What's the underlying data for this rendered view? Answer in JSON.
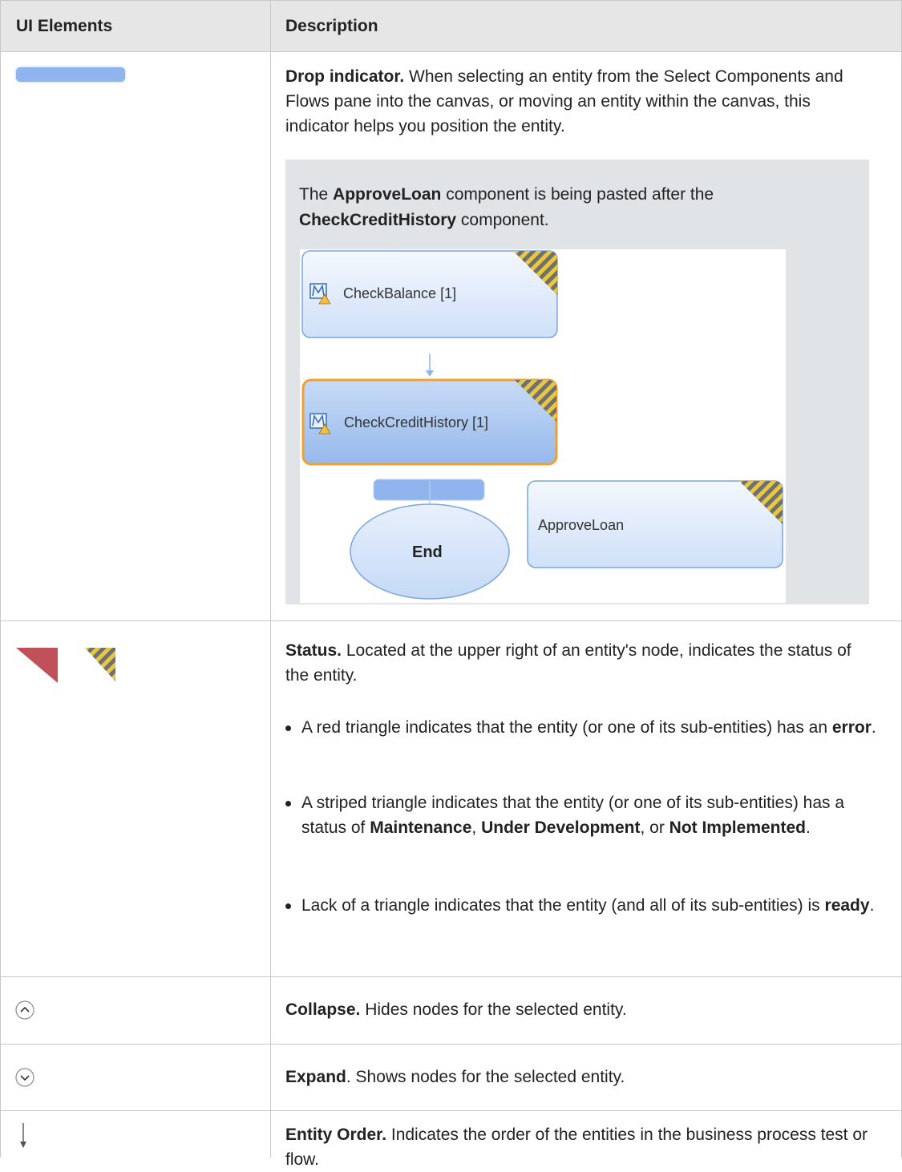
{
  "header": {
    "col1": "UI Elements",
    "col2": "Description"
  },
  "rows": {
    "drop": {
      "title": "Drop indicator.",
      "text": " When selecting an entity from the Select Components and Flows pane into the canvas, or moving an entity within the canvas, this indicator helps you position the entity.",
      "note": {
        "pre": "The ",
        "b1": "ApproveLoan",
        "mid": " component is being pasted after the ",
        "b2": "CheckCreditHistory",
        "post": " component."
      },
      "diagram": {
        "node1": "CheckBalance [1]",
        "node2": "CheckCreditHistory [1]",
        "end": "End",
        "pending": "ApproveLoan"
      }
    },
    "status": {
      "title": "Status.",
      "text": " Located at the upper right of an entity's node, indicates the status of the entity.",
      "b1": {
        "pre": "A red triangle indicates that the entity (or one of its sub-entities) has an ",
        "bold": "error",
        "post": "."
      },
      "b2": {
        "pre": "A striped triangle indicates that the entity (or one of its sub-entities) has a status of ",
        "bold1": "Maintenance",
        "sep1": ", ",
        "bold2": "Under Development",
        "sep2": ", or ",
        "bold3": "Not Implemented",
        "post": "."
      },
      "b3": {
        "pre": "Lack of a triangle indicates that the entity (and all of its sub-entities) is ",
        "bold": "ready",
        "post": "."
      }
    },
    "collapse": {
      "title": "Collapse.",
      "text": " Hides nodes for the selected entity."
    },
    "expand": {
      "title": "Expand",
      "text": ". Shows nodes for the selected entity."
    },
    "order": {
      "title": "Entity Order.",
      "text": " Indicates the order of the entities in the business process test or flow."
    }
  },
  "colors": {
    "accent_blue": "#8fb4ee",
    "error_red": "#c0505a",
    "selected_orange": "#f0a030",
    "stripe_yellow": "#e8c840"
  }
}
